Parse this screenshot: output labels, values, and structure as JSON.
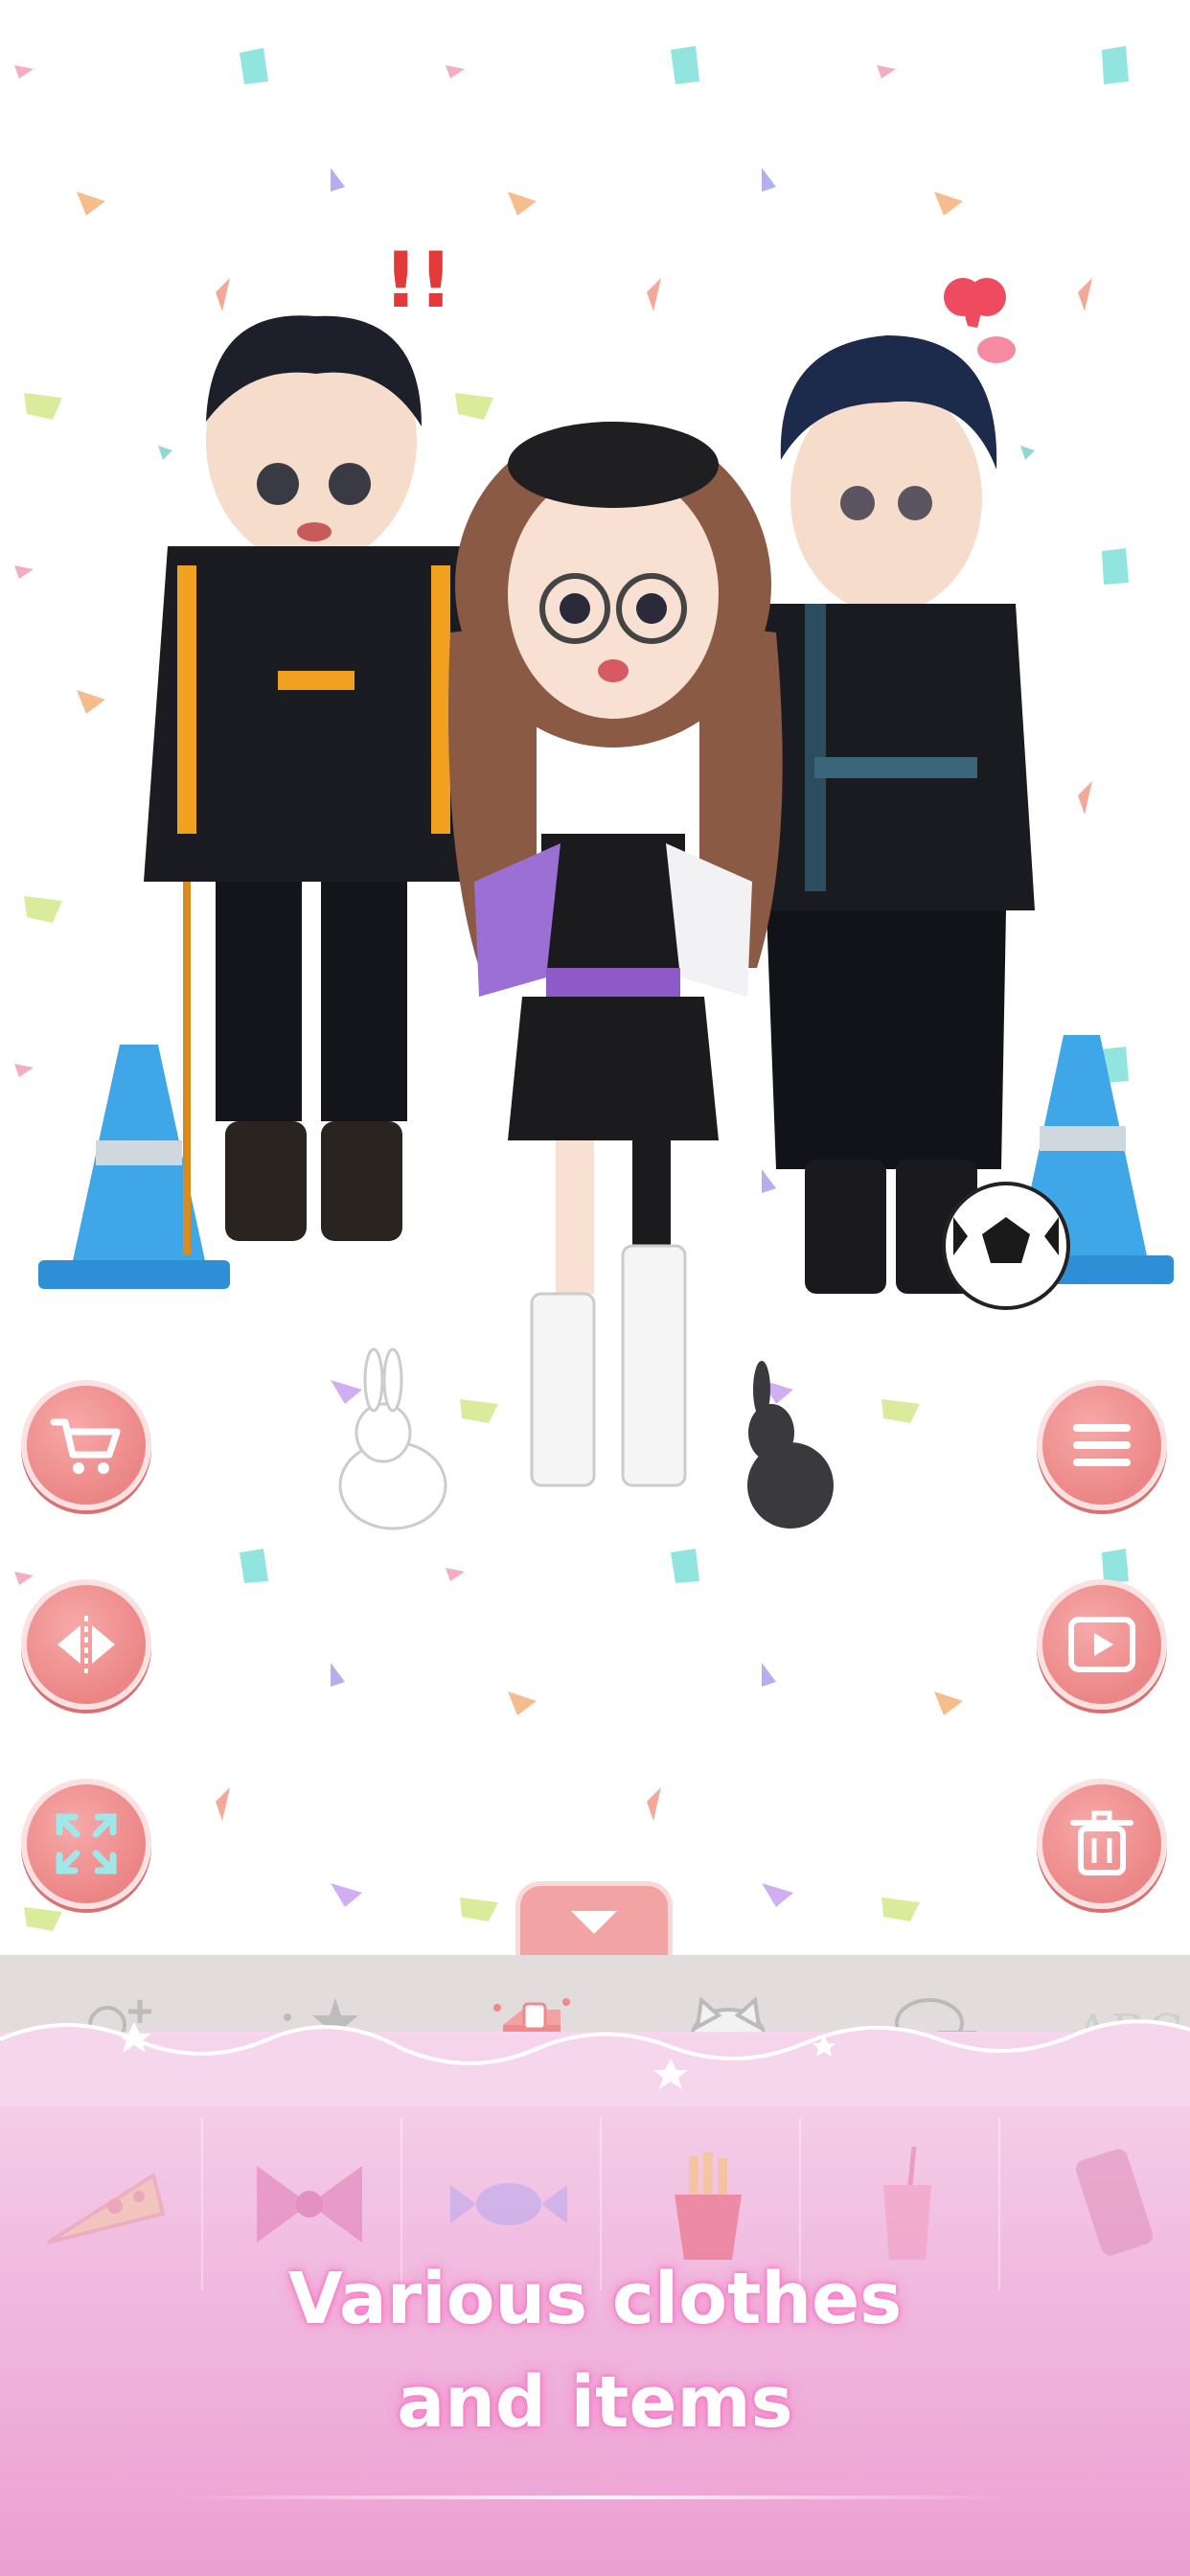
{
  "caption": {
    "line1": "Various clothes",
    "line2": "and items"
  },
  "tabs": [
    {
      "name": "add-character",
      "icon": "person-plus-icon",
      "selected": false
    },
    {
      "name": "stickers",
      "icon": "stars-icon",
      "selected": false
    },
    {
      "name": "items",
      "icon": "gift-box-icon",
      "selected": true
    },
    {
      "name": "pets",
      "icon": "cat-icon",
      "selected": false
    },
    {
      "name": "speech",
      "icon": "speech-bubble-icon",
      "selected": false
    },
    {
      "name": "text",
      "icon": "text-icon",
      "selected": false,
      "label": "ABC"
    }
  ],
  "left_buttons": [
    "cart-icon",
    "flip-icon",
    "expand-icon"
  ],
  "right_buttons": [
    "menu-icon",
    "video-icon",
    "trash-icon"
  ],
  "item_slots": [
    "pizza-icon",
    "bow-icon",
    "candy-icon",
    "fries-icon",
    "drink-icon",
    "phone-icon"
  ],
  "colors": {
    "button_pink": "#ec8686",
    "panel_pink": "#ec9fd2",
    "tab_bar": "#e3dcdc"
  }
}
